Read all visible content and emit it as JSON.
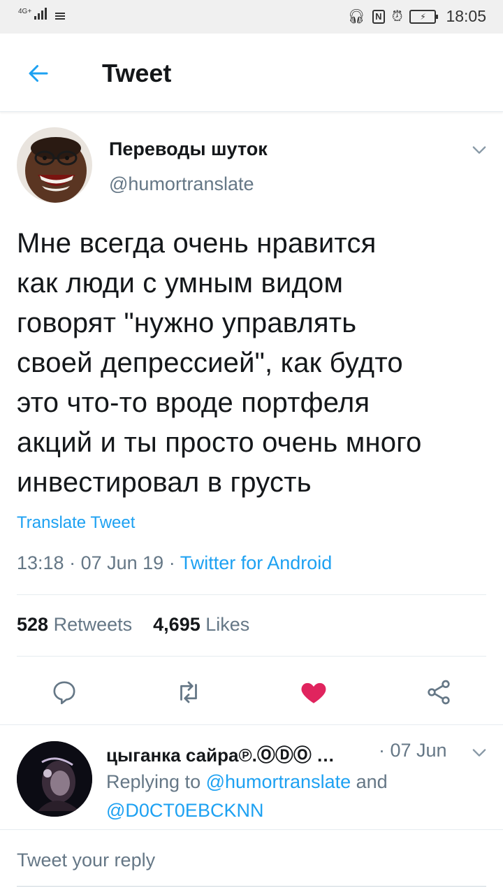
{
  "status_bar": {
    "network": "4G+",
    "time": "18:05"
  },
  "header": {
    "title": "Tweet"
  },
  "tweet": {
    "author_name": "Переводы шуток",
    "author_handle": "@humortranslate",
    "text": "Мне всегда очень нравится\nкак люди с умным видом\nговорят \"нужно управлять\nсвоей депрессией\", как будто\nэто что-то вроде портфеля\nакций и ты просто очень много\nинвестировал в грусть",
    "translate_label": "Translate Tweet",
    "time": "13:18",
    "date": "07 Jun 19",
    "client": "Twitter for Android",
    "retweets_count": "528",
    "retweets_label": "Retweets",
    "likes_count": "4,695",
    "likes_label": "Likes"
  },
  "reply": {
    "author_name": "цыганка сайра℗.ⓄⒹⓄ …",
    "time": "· 07 Jun",
    "replying_prefix": "Replying to",
    "mention_1": "@humortranslate",
    "and_word": "and",
    "mention_2": "@D0CT0EBCKNN"
  },
  "reply_box": {
    "placeholder": "Tweet your reply"
  },
  "colors": {
    "accent": "#1da1f2",
    "secondary_text": "#657786",
    "like": "#e0245e",
    "divider": "#e6ecf0"
  },
  "icons": [
    "back-arrow-icon",
    "chevron-down-icon",
    "reply-icon",
    "retweet-icon",
    "like-heart-icon",
    "share-icon"
  ]
}
